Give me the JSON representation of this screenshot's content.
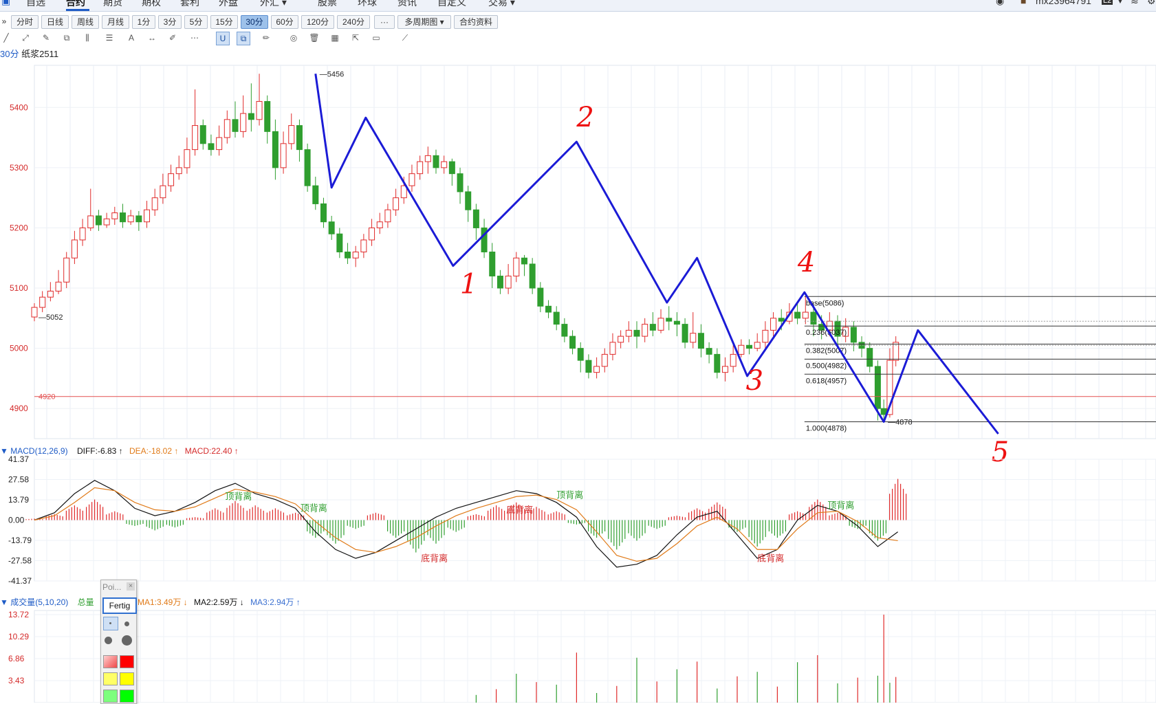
{
  "menu": {
    "items": [
      {
        "label": "自选"
      },
      {
        "label": "合约"
      },
      {
        "label": "期货"
      },
      {
        "label": "期权"
      },
      {
        "label": "套利"
      },
      {
        "label": "外盘"
      },
      {
        "label": "外汇 ▾"
      },
      {
        "label": "股票"
      },
      {
        "label": "环球"
      },
      {
        "label": "资讯"
      },
      {
        "label": "自定义"
      },
      {
        "label": "交易 ▾"
      }
    ],
    "active": "合约",
    "user": "mx23964791",
    "user_badge": "L2"
  },
  "periods": {
    "items": [
      {
        "label": "分时"
      },
      {
        "label": "日线"
      },
      {
        "label": "周线"
      },
      {
        "label": "月线"
      },
      {
        "label": "1分"
      },
      {
        "label": "3分"
      },
      {
        "label": "5分"
      },
      {
        "label": "15分"
      },
      {
        "label": "30分"
      },
      {
        "label": "60分"
      },
      {
        "label": "120分"
      },
      {
        "label": "240分"
      },
      {
        "label": "···"
      },
      {
        "label": "多周期图 ▾"
      },
      {
        "label": "合约资料"
      }
    ],
    "active": "30分"
  },
  "toolbar": {
    "tools": [
      "line-icon",
      "ray-icon",
      "pen-icon",
      "rect-icon",
      "candle-icon",
      "fib-icon",
      "text-icon",
      "arrows-icon",
      "brush-icon",
      "more-icon",
      "magnet-icon",
      "copy-icon",
      "edit-icon",
      "eye-icon",
      "trash-icon",
      "layers-icon",
      "export-icon",
      "comment-icon",
      "ruler-icon"
    ]
  },
  "instrument": {
    "period": "30分",
    "name": "纸浆2511"
  },
  "colors": {
    "up": "#e02a2a",
    "down": "#2f9e2f",
    "wave": "#1b1bd6",
    "handwriting": "#ee1111",
    "dif": "#111111",
    "dea": "#e07a18",
    "level_line": "#e35050"
  },
  "macd_header": {
    "name": "MACD(12,26,9)",
    "dif": "DIFF:-6.83 ↑",
    "dea": "DEA:-18.02 ↑",
    "macd": "MACD:22.40 ↑"
  },
  "volume_header": {
    "name": "成交量(5,10,20)",
    "total": "总量",
    "ma1": "MA1:3.49万 ↓",
    "ma2": "MA2:2.59万 ↓",
    "ma3": "MA3:2.94万 ↑"
  },
  "point_panel": {
    "title": "Poi...",
    "close": "×",
    "done": "Fertig"
  },
  "chart_data": [
    {
      "type": "candlestick",
      "title": "30分 纸浆2511",
      "ylim": [
        4850,
        5470
      ],
      "yticks": [
        "5400",
        "5300",
        "5200",
        "5100",
        "5000",
        "4900"
      ],
      "price_labels": [
        {
          "text": "5456",
          "x": 0.28,
          "y": 5456
        },
        {
          "text": "5052",
          "x": 0.0,
          "y": 5052
        },
        {
          "text": "4878",
          "x": 0.846,
          "y": 4878
        },
        {
          "text": "4920",
          "x": 0.0,
          "y": 4920
        }
      ],
      "horizontal_level": 4920,
      "wave_points": [
        {
          "x": 0.28,
          "y": 5456
        },
        {
          "x": 0.296,
          "y": 5267
        },
        {
          "x": 0.33,
          "y": 5383
        },
        {
          "x": 0.417,
          "y": 5137
        },
        {
          "x": 0.54,
          "y": 5343
        },
        {
          "x": 0.63,
          "y": 5076
        },
        {
          "x": 0.66,
          "y": 5150
        },
        {
          "x": 0.71,
          "y": 4954
        },
        {
          "x": 0.767,
          "y": 5093
        },
        {
          "x": 0.846,
          "y": 4878
        },
        {
          "x": 0.88,
          "y": 5030
        },
        {
          "x": 0.96,
          "y": 4858
        }
      ],
      "wave_labels": [
        "1",
        "2",
        "3",
        "4",
        "5"
      ],
      "fibonacci": [
        {
          "label": "base(5086)",
          "value": 5086
        },
        {
          "label": "0.236(5037)",
          "value": 5037
        },
        {
          "label": "0.382(5007)",
          "value": 5007
        },
        {
          "label": "0.500(4982)",
          "value": 4982
        },
        {
          "label": "0.618(4957)",
          "value": 4957
        },
        {
          "label": "1.000(4878)",
          "value": 4878
        }
      ],
      "fib_extra_lines": [
        5045,
        5005
      ],
      "candles": [
        [
          0.0,
          5052,
          5068,
          5045,
          5075
        ],
        [
          0.008,
          5068,
          5085,
          5060,
          5095
        ],
        [
          0.016,
          5085,
          5095,
          5078,
          5110
        ],
        [
          0.024,
          5095,
          5110,
          5090,
          5130
        ],
        [
          0.032,
          5110,
          5150,
          5100,
          5160
        ],
        [
          0.04,
          5150,
          5180,
          5140,
          5195
        ],
        [
          0.048,
          5180,
          5200,
          5170,
          5215
        ],
        [
          0.056,
          5200,
          5220,
          5195,
          5265
        ],
        [
          0.064,
          5220,
          5205,
          5195,
          5230
        ],
        [
          0.072,
          5205,
          5215,
          5200,
          5225
        ],
        [
          0.08,
          5215,
          5225,
          5205,
          5235
        ],
        [
          0.088,
          5225,
          5210,
          5200,
          5240
        ],
        [
          0.096,
          5210,
          5220,
          5205,
          5230
        ],
        [
          0.104,
          5220,
          5210,
          5195,
          5228
        ],
        [
          0.112,
          5210,
          5230,
          5200,
          5245
        ],
        [
          0.12,
          5230,
          5250,
          5220,
          5265
        ],
        [
          0.128,
          5250,
          5270,
          5240,
          5290
        ],
        [
          0.136,
          5270,
          5290,
          5260,
          5305
        ],
        [
          0.144,
          5290,
          5300,
          5280,
          5320
        ],
        [
          0.152,
          5300,
          5330,
          5290,
          5350
        ],
        [
          0.16,
          5330,
          5370,
          5320,
          5430
        ],
        [
          0.168,
          5370,
          5340,
          5330,
          5380
        ],
        [
          0.176,
          5340,
          5330,
          5320,
          5355
        ],
        [
          0.184,
          5330,
          5350,
          5320,
          5370
        ],
        [
          0.192,
          5350,
          5380,
          5340,
          5395
        ],
        [
          0.2,
          5380,
          5360,
          5350,
          5410
        ],
        [
          0.208,
          5360,
          5390,
          5350,
          5420
        ],
        [
          0.216,
          5390,
          5380,
          5360,
          5440
        ],
        [
          0.224,
          5380,
          5410,
          5370,
          5456
        ],
        [
          0.232,
          5410,
          5360,
          5340,
          5420
        ],
        [
          0.24,
          5360,
          5300,
          5280,
          5380
        ],
        [
          0.248,
          5300,
          5340,
          5290,
          5360
        ],
        [
          0.256,
          5340,
          5370,
          5330,
          5390
        ],
        [
          0.264,
          5370,
          5330,
          5310,
          5380
        ],
        [
          0.272,
          5330,
          5270,
          5260,
          5340
        ],
        [
          0.28,
          5270,
          5240,
          5230,
          5285
        ],
        [
          0.288,
          5240,
          5210,
          5200,
          5250
        ],
        [
          0.296,
          5210,
          5190,
          5180,
          5220
        ],
        [
          0.304,
          5190,
          5160,
          5150,
          5200
        ],
        [
          0.312,
          5160,
          5150,
          5140,
          5175
        ],
        [
          0.32,
          5150,
          5160,
          5135,
          5170
        ],
        [
          0.328,
          5160,
          5180,
          5150,
          5190
        ],
        [
          0.336,
          5180,
          5200,
          5170,
          5215
        ],
        [
          0.344,
          5200,
          5210,
          5190,
          5225
        ],
        [
          0.352,
          5210,
          5230,
          5200,
          5240
        ],
        [
          0.36,
          5230,
          5250,
          5220,
          5265
        ],
        [
          0.368,
          5250,
          5270,
          5240,
          5285
        ],
        [
          0.376,
          5270,
          5290,
          5260,
          5305
        ],
        [
          0.384,
          5290,
          5310,
          5280,
          5320
        ],
        [
          0.392,
          5310,
          5320,
          5290,
          5335
        ],
        [
          0.4,
          5320,
          5300,
          5290,
          5330
        ],
        [
          0.408,
          5300,
          5310,
          5290,
          5320
        ],
        [
          0.416,
          5310,
          5290,
          5270,
          5315
        ],
        [
          0.424,
          5290,
          5260,
          5240,
          5300
        ],
        [
          0.432,
          5260,
          5230,
          5210,
          5270
        ],
        [
          0.44,
          5230,
          5200,
          5180,
          5240
        ],
        [
          0.448,
          5200,
          5160,
          5150,
          5215
        ],
        [
          0.456,
          5160,
          5120,
          5100,
          5175
        ],
        [
          0.464,
          5120,
          5100,
          5090,
          5130
        ],
        [
          0.472,
          5100,
          5120,
          5090,
          5140
        ],
        [
          0.48,
          5120,
          5150,
          5110,
          5160
        ],
        [
          0.488,
          5150,
          5140,
          5120,
          5155
        ],
        [
          0.496,
          5140,
          5100,
          5090,
          5150
        ],
        [
          0.504,
          5100,
          5070,
          5060,
          5110
        ],
        [
          0.512,
          5070,
          5060,
          5050,
          5080
        ],
        [
          0.52,
          5060,
          5040,
          5030,
          5070
        ],
        [
          0.528,
          5040,
          5020,
          5010,
          5050
        ],
        [
          0.536,
          5020,
          5000,
          4990,
          5030
        ],
        [
          0.544,
          5000,
          4980,
          4960,
          5010
        ],
        [
          0.552,
          4980,
          4960,
          4950,
          4990
        ],
        [
          0.56,
          4960,
          4970,
          4950,
          4985
        ],
        [
          0.568,
          4970,
          4990,
          4960,
          5000
        ],
        [
          0.576,
          4990,
          5010,
          4980,
          5025
        ],
        [
          0.584,
          5010,
          5020,
          5000,
          5030
        ],
        [
          0.592,
          5020,
          5030,
          5010,
          5045
        ],
        [
          0.6,
          5030,
          5020,
          5000,
          5045
        ],
        [
          0.608,
          5020,
          5040,
          5010,
          5050
        ],
        [
          0.616,
          5040,
          5030,
          5020,
          5060
        ],
        [
          0.624,
          5030,
          5050,
          5025,
          5065
        ],
        [
          0.632,
          5050,
          5045,
          5030,
          5070
        ],
        [
          0.64,
          5045,
          5040,
          5020,
          5060
        ],
        [
          0.648,
          5040,
          5010,
          5000,
          5050
        ],
        [
          0.656,
          5010,
          5025,
          5000,
          5060
        ],
        [
          0.664,
          5025,
          5000,
          4985,
          5040
        ],
        [
          0.672,
          5000,
          4990,
          4975,
          5010
        ],
        [
          0.68,
          4990,
          4960,
          4950,
          5000
        ],
        [
          0.688,
          4960,
          4970,
          4945,
          4985
        ],
        [
          0.696,
          4970,
          4990,
          4960,
          5005
        ],
        [
          0.704,
          4990,
          5005,
          4985,
          5015
        ],
        [
          0.712,
          5005,
          5000,
          4990,
          5015
        ],
        [
          0.72,
          5000,
          5010,
          4995,
          5025
        ],
        [
          0.728,
          5010,
          5030,
          5000,
          5045
        ],
        [
          0.736,
          5030,
          5050,
          5020,
          5060
        ],
        [
          0.744,
          5050,
          5045,
          5030,
          5065
        ],
        [
          0.752,
          5045,
          5060,
          5040,
          5075
        ],
        [
          0.76,
          5060,
          5050,
          5040,
          5075
        ],
        [
          0.768,
          5050,
          5060,
          5040,
          5086
        ],
        [
          0.776,
          5060,
          5040,
          5020,
          5070
        ],
        [
          0.784,
          5040,
          5030,
          5015,
          5055
        ],
        [
          0.792,
          5030,
          5045,
          5020,
          5060
        ],
        [
          0.8,
          5045,
          5020,
          5000,
          5055
        ],
        [
          0.808,
          5020,
          5035,
          5010,
          5050
        ],
        [
          0.816,
          5035,
          5010,
          4995,
          5045
        ],
        [
          0.824,
          5010,
          5000,
          4985,
          5020
        ],
        [
          0.832,
          5000,
          4970,
          4960,
          5010
        ],
        [
          0.84,
          4970,
          4900,
          4880,
          4980
        ],
        [
          0.846,
          4900,
          4890,
          4878,
          4915
        ],
        [
          0.852,
          4890,
          4980,
          4885,
          5000
        ],
        [
          0.858,
          4980,
          5010,
          4970,
          5020
        ]
      ]
    },
    {
      "type": "bar",
      "title": "MACD(12,26,9)",
      "ylim": [
        -41.37,
        41.37
      ],
      "yticks": [
        "41.37",
        "27.58",
        "13.79",
        "0.00",
        "-13.79",
        "-27.58",
        "-41.37"
      ],
      "annotations": [
        {
          "text": "顶背离",
          "x": 0.19,
          "y": 14
        },
        {
          "text": "顶背离",
          "x": 0.265,
          "y": 6
        },
        {
          "text": "底背离",
          "x": 0.385,
          "y": -28
        },
        {
          "text": "底背离",
          "x": 0.47,
          "y": 5
        },
        {
          "text": "顶背离",
          "x": 0.52,
          "y": 15
        },
        {
          "text": "底背离",
          "x": 0.72,
          "y": -28
        },
        {
          "text": "顶背离",
          "x": 0.79,
          "y": 8
        }
      ],
      "x": [
        0.0,
        0.02,
        0.04,
        0.06,
        0.08,
        0.1,
        0.12,
        0.14,
        0.16,
        0.18,
        0.2,
        0.22,
        0.24,
        0.26,
        0.28,
        0.3,
        0.32,
        0.34,
        0.36,
        0.38,
        0.4,
        0.42,
        0.44,
        0.46,
        0.48,
        0.5,
        0.52,
        0.54,
        0.56,
        0.58,
        0.6,
        0.62,
        0.64,
        0.66,
        0.68,
        0.7,
        0.72,
        0.74,
        0.76,
        0.78,
        0.8,
        0.82,
        0.84,
        0.86
      ],
      "hist": [
        1,
        4,
        10,
        14,
        6,
        -4,
        -7,
        -5,
        2,
        8,
        13,
        10,
        8,
        5,
        -12,
        -16,
        -6,
        5,
        -12,
        -22,
        -16,
        -8,
        4,
        10,
        12,
        9,
        6,
        -3,
        -12,
        -20,
        -14,
        -6,
        3,
        8,
        12,
        -8,
        -18,
        -12,
        6,
        14,
        5,
        -6,
        -14,
        28
      ],
      "dif": [
        0,
        5,
        18,
        27,
        20,
        8,
        3,
        6,
        12,
        20,
        25,
        18,
        14,
        8,
        -8,
        -20,
        -26,
        -22,
        -14,
        -6,
        2,
        8,
        12,
        16,
        20,
        18,
        12,
        2,
        -18,
        -32,
        -30,
        -24,
        -10,
        2,
        6,
        -10,
        -26,
        -20,
        0,
        10,
        6,
        -4,
        -18,
        -8
      ],
      "dea": [
        0,
        3,
        12,
        22,
        20,
        12,
        7,
        6,
        9,
        15,
        21,
        19,
        16,
        11,
        -1,
        -12,
        -20,
        -22,
        -18,
        -12,
        -4,
        3,
        8,
        12,
        16,
        17,
        14,
        7,
        -8,
        -24,
        -28,
        -26,
        -16,
        -4,
        2,
        -6,
        -20,
        -20,
        -6,
        5,
        6,
        -1,
        -12,
        -14
      ]
    },
    {
      "type": "bar",
      "title": "成交量(5,10,20)",
      "ylim": [
        0,
        13.72
      ],
      "yticks": [
        "13.72",
        "10.29",
        "6.86",
        "3.43"
      ],
      "x": [
        0.44,
        0.46,
        0.48,
        0.5,
        0.52,
        0.54,
        0.56,
        0.58,
        0.6,
        0.62,
        0.64,
        0.66,
        0.68,
        0.7,
        0.72,
        0.74,
        0.76,
        0.78,
        0.8,
        0.82,
        0.84,
        0.846,
        0.852,
        0.858
      ],
      "values": [
        1.2,
        2.1,
        4.5,
        3.2,
        2.8,
        7.8,
        1.5,
        2.6,
        7.0,
        3.3,
        5.2,
        6.4,
        2.2,
        4.1,
        4.8,
        2.5,
        6.3,
        7.4,
        3.0,
        3.9,
        4.2,
        13.72,
        3.1,
        4.0
      ]
    }
  ]
}
